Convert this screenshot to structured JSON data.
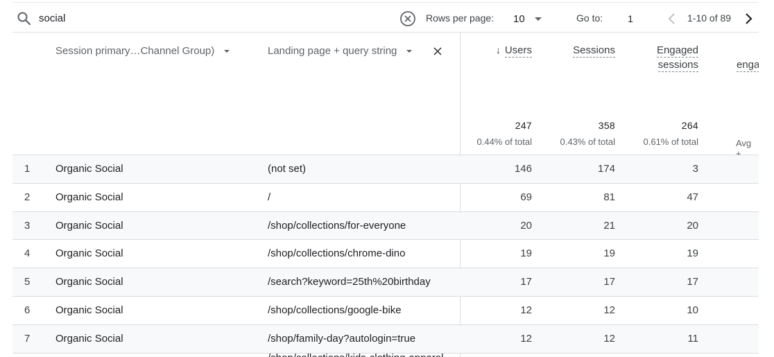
{
  "toolbar": {
    "search_value": "social",
    "search_icon": "search-icon",
    "clear_icon": "clear-circle-icon",
    "rows_per_page_label": "Rows per page:",
    "rows_per_page_value": "10",
    "goto_label": "Go to:",
    "goto_value": "1",
    "page_range": "1-10 of 89",
    "prev_disabled": true,
    "next_disabled": false
  },
  "columns": {
    "dimension_1": "Session primary…Channel Group)",
    "dimension_2": "Landing page + query string",
    "metrics": [
      {
        "label_line1": "Users",
        "label_line2": "",
        "sorted": "desc"
      },
      {
        "label_line1": "Sessions",
        "label_line2": ""
      },
      {
        "label_line1": "Engaged",
        "label_line2": "sessions"
      },
      {
        "label_line1": "enga",
        "label_line2": ""
      }
    ]
  },
  "totals": {
    "users": {
      "value": "247",
      "pct": "0.44% of total"
    },
    "sessions": {
      "value": "358",
      "pct": "0.43% of total"
    },
    "engaged_sessions": {
      "value": "264",
      "pct": "0.61% of total"
    },
    "cut_off": "Avg +"
  },
  "rows": [
    {
      "idx": "1",
      "channel": "Organic Social",
      "landing": "(not set)",
      "users": "146",
      "sessions": "174",
      "engaged": "3"
    },
    {
      "idx": "2",
      "channel": "Organic Social",
      "landing": "/",
      "users": "69",
      "sessions": "81",
      "engaged": "47"
    },
    {
      "idx": "3",
      "channel": "Organic Social",
      "landing": "/shop/collections/for-everyone",
      "users": "20",
      "sessions": "21",
      "engaged": "20"
    },
    {
      "idx": "4",
      "channel": "Organic Social",
      "landing": "/shop/collections/chrome-dino",
      "users": "19",
      "sessions": "19",
      "engaged": "19"
    },
    {
      "idx": "5",
      "channel": "Organic Social",
      "landing": "/search?keyword=25th%20birthday",
      "users": "17",
      "sessions": "17",
      "engaged": "17"
    },
    {
      "idx": "6",
      "channel": "Organic Social",
      "landing": "/shop/collections/google-bike",
      "users": "12",
      "sessions": "12",
      "engaged": "10"
    },
    {
      "idx": "7",
      "channel": "Organic Social",
      "landing": "/shop/family-day?autologin=true",
      "users": "12",
      "sessions": "12",
      "engaged": "11"
    }
  ],
  "peek_row_text": "/shop/collections/kids-clothing-apparel",
  "colors": {
    "alt_row": "#f8f9fa",
    "divider": "#dadce0",
    "text": "#202124",
    "muted": "#5f6368",
    "disabled_icon": "#bdc1c6"
  }
}
